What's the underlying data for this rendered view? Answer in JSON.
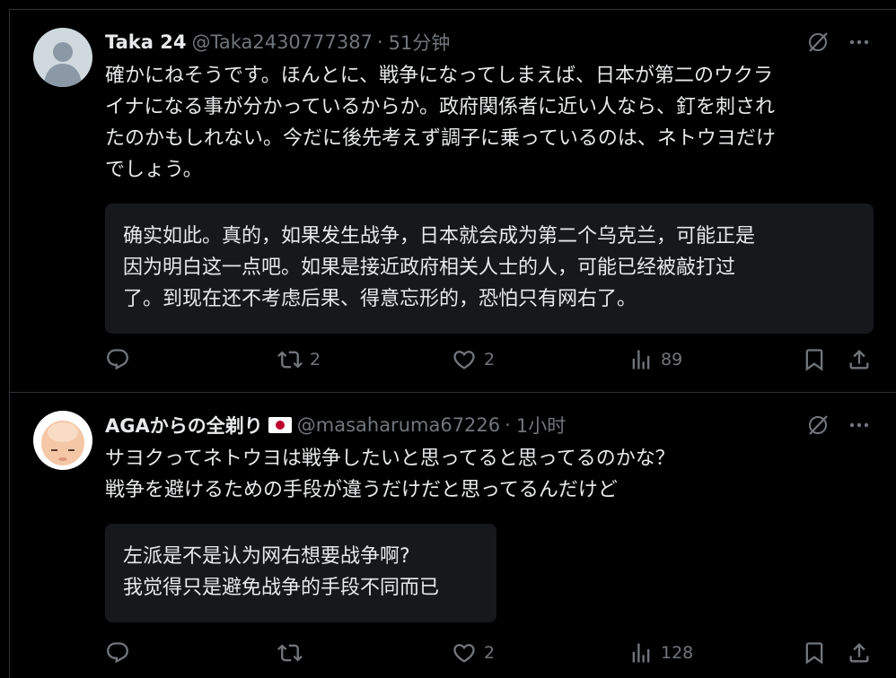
{
  "posts": [
    {
      "name": "Taka 24",
      "handle": "@Taka2430777387",
      "separator": "·",
      "time": "51分钟",
      "text": "確かにねそうです。ほんとに、戦争になってしまえば、日本が第二のウクラ\nイナになる事が分かっているからか。政府関係者に近い人なら、釘を刺され\nたのかもしれない。今だに後先考えず調子に乗っているのは、ネトウヨだけ\nでしょう。",
      "translation": "确实如此。真的，如果发生战争，日本就会成为第二个乌克兰，可能正是\n因为明白这一点吧。如果是接近政府相关人士的人，可能已经被敲打过\n了。到现在还不考虑后果、得意忘形的，恐怕只有网右了。",
      "reposts": "2",
      "likes": "2",
      "views": "89",
      "avatar_icon": "default-profile-icon"
    },
    {
      "name": "AGAからの全剃り",
      "handle": "@masaharuma67226",
      "separator": "·",
      "time": "1小时",
      "text": "サヨクってネトウヨは戦争したいと思ってると思ってるのかな？\n戦争を避けるための手段が違うだけだと思ってるんだけど",
      "translation": "左派是不是认为网右想要战争啊?\n我觉得只是避免战争的手段不同而已",
      "reposts": "",
      "likes": "2",
      "views": "128",
      "avatar_icon": "bald-head-avatar-icon",
      "flag_icon": "japan-flag-icon"
    }
  ],
  "colors": {
    "background": "#000000",
    "text": "#e7e9ea",
    "muted": "#71767b",
    "divider": "#2f3336",
    "translation_bg": "#16181c"
  }
}
